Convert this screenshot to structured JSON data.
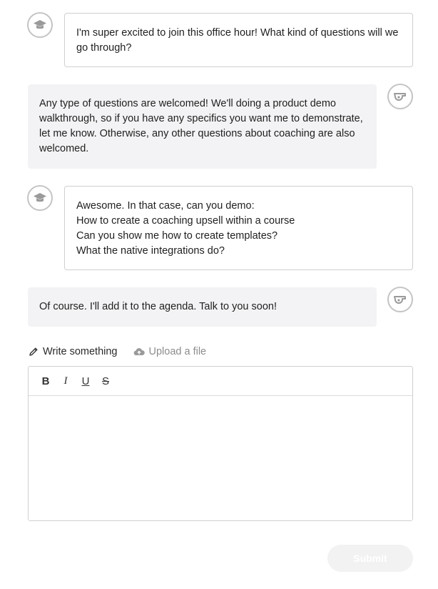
{
  "messages": [
    {
      "side": "outgoing",
      "avatar_icon": "graduation-cap-icon",
      "lines": [
        "I'm super excited to join this office hour! What kind of questions will we go through?"
      ]
    },
    {
      "side": "incoming",
      "avatar_icon": "whistle-icon",
      "lines": [
        "Any type of questions are welcomed! We'll doing a product demo walkthrough, so if you have any specifics you want me to demonstrate, let me know. Otherwise, any other questions about coaching are also welcomed."
      ]
    },
    {
      "side": "outgoing",
      "avatar_icon": "graduation-cap-icon",
      "lines": [
        "Awesome. In that case, can you demo:",
        "How to create a coaching upsell within a course",
        "Can you show me how to create templates?",
        "What the native integrations do?"
      ]
    },
    {
      "side": "incoming",
      "avatar_icon": "whistle-icon",
      "lines": [
        "Of course. I'll add it to the agenda. Talk to you soon!"
      ]
    }
  ],
  "composer": {
    "tabs": [
      {
        "label": "Write something",
        "icon": "pencil-icon",
        "active": true
      },
      {
        "label": "Upload a file",
        "icon": "cloud-upload-icon",
        "active": false
      }
    ],
    "toolbar": {
      "bold": "B",
      "italic": "I",
      "underline": "U",
      "strike": "S"
    },
    "submit_label": "Submit"
  },
  "colors": {
    "avatar_border": "#c4c4c4",
    "incoming_bg": "#f3f3f5",
    "submit_bg": "#f2f2f2"
  }
}
